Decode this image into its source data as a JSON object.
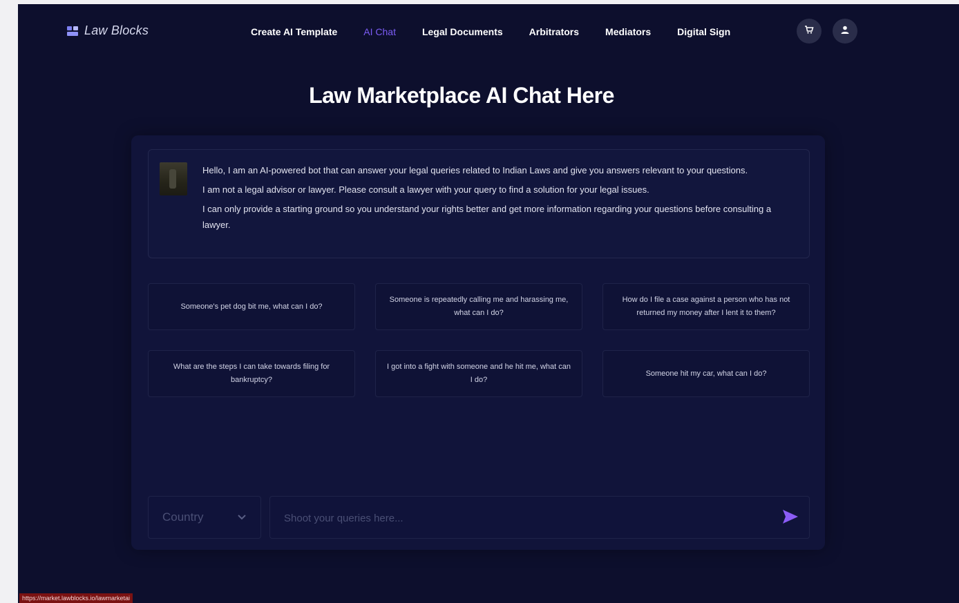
{
  "brand": {
    "name": "Law Blocks"
  },
  "nav": {
    "items": [
      {
        "label": "Create AI Template",
        "active": false
      },
      {
        "label": "AI Chat",
        "active": true
      },
      {
        "label": "Legal Documents",
        "active": false
      },
      {
        "label": "Arbitrators",
        "active": false
      },
      {
        "label": "Mediators",
        "active": false
      },
      {
        "label": "Digital Sign",
        "active": false
      }
    ],
    "cart_icon": "cart-icon",
    "user_icon": "user-icon"
  },
  "page": {
    "title": "Law Marketplace AI Chat Here"
  },
  "bot_message": {
    "lines": [
      "Hello, I am an AI-powered bot that can answer your legal queries related to Indian Laws and give you answers relevant to your questions.",
      "I am not a legal advisor or lawyer. Please consult a lawyer with your query to find a solution for your legal issues.",
      "I can only provide a starting ground so you understand your rights better and get more information regarding your questions before consulting a lawyer."
    ]
  },
  "suggestions": [
    "Someone's pet dog bit me, what can I do?",
    "Someone is repeatedly calling me and harassing me, what can I do?",
    "How do I file a case against a person who has not returned my money after I lent it to them?",
    "What are the steps I can take towards filing for bankruptcy?",
    "I got into a fight with someone and he hit me, what can I do?",
    "Someone hit my car, what can I do?"
  ],
  "composer": {
    "country_placeholder": "Country",
    "query_placeholder": "Shoot your queries here...",
    "send_icon": "send-icon"
  },
  "status_bar": {
    "url": "https://market.lawblocks.io/lawmarketai"
  },
  "colors": {
    "background": "#0d0f2d",
    "panel": "#11143a",
    "accent": "#7c5cf5",
    "text": "#ffffff"
  }
}
